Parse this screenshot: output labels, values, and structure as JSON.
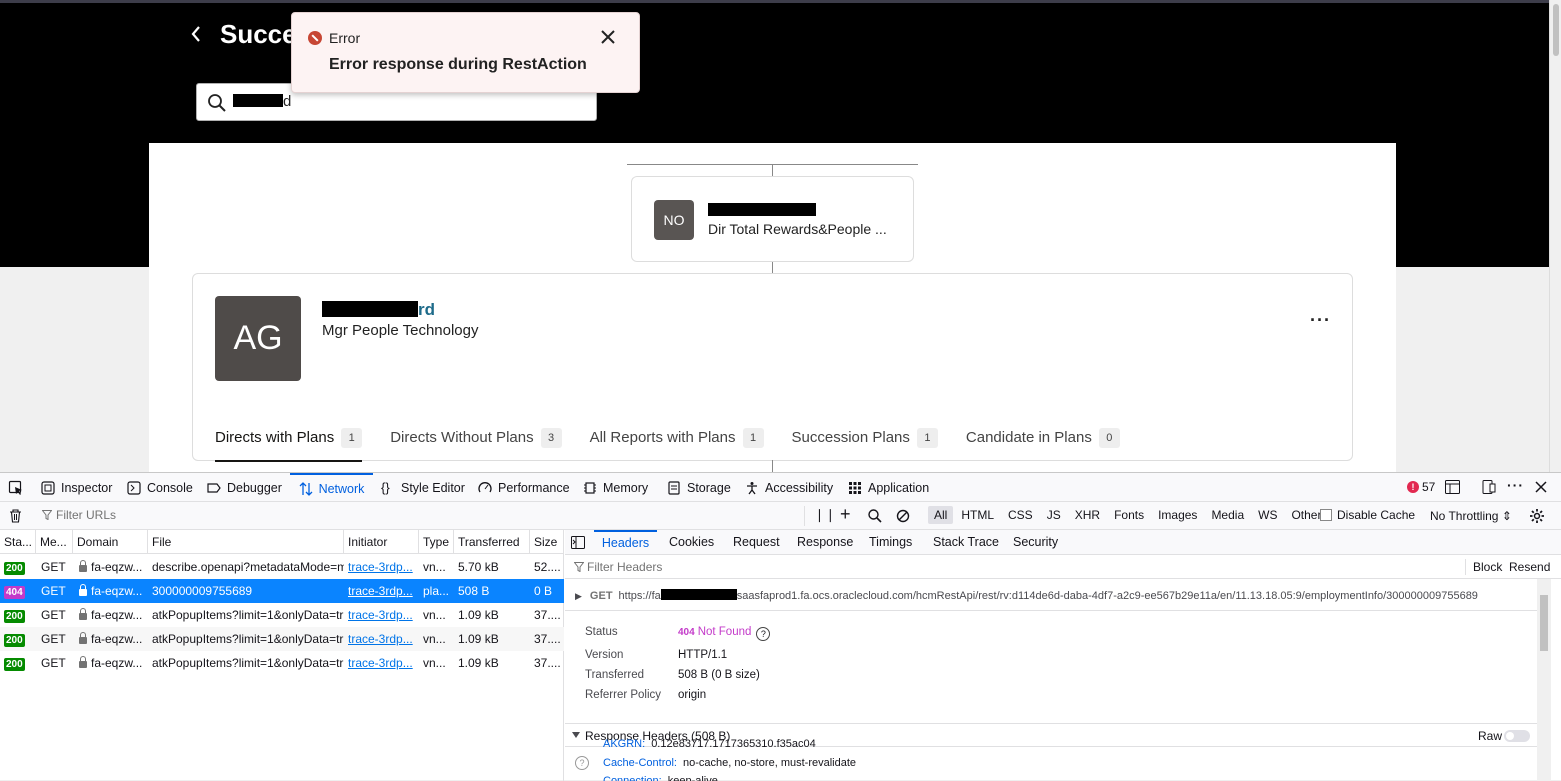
{
  "app": {
    "page_title": "Succes",
    "search_value_tail": "d",
    "toast": {
      "title": "Error",
      "message": "Error response during RestAction"
    },
    "manager": {
      "initials": "NO",
      "title": "Dir Total Rewards&People ..."
    },
    "employee": {
      "initials": "AG",
      "name_tail": "rd",
      "title": "Mgr People Technology",
      "more": "···"
    },
    "tabs": [
      {
        "label": "Directs with Plans",
        "count": "1"
      },
      {
        "label": "Directs Without Plans",
        "count": "3"
      },
      {
        "label": "All Reports with Plans",
        "count": "1"
      },
      {
        "label": "Succession Plans",
        "count": "1"
      },
      {
        "label": "Candidate in Plans",
        "count": "0"
      }
    ]
  },
  "devtools": {
    "tabs": [
      "Inspector",
      "Console",
      "Debugger",
      "Network",
      "Style Editor",
      "Performance",
      "Memory",
      "Storage",
      "Accessibility",
      "Application"
    ],
    "error_count": "57",
    "filter_placeholder": "Filter URLs",
    "type_filters": [
      "All",
      "HTML",
      "CSS",
      "JS",
      "XHR",
      "Fonts",
      "Images",
      "Media",
      "WS",
      "Other"
    ],
    "disable_cache": "Disable Cache",
    "throttling": "No Throttling ⇕",
    "columns": [
      "Sta...",
      "Me...",
      "Domain",
      "File",
      "Initiator",
      "Type",
      "Transferred",
      "Size"
    ],
    "requests": [
      {
        "status": "200",
        "method": "GET",
        "domain": "fa-eqzw...",
        "file": "describe.openapi?metadataMode=m",
        "initiator": "trace-3rdp...",
        "type": "vn...",
        "transferred": "5.70 kB",
        "size": "52...."
      },
      {
        "status": "404",
        "method": "GET",
        "domain": "fa-eqzw...",
        "file": "300000009755689",
        "initiator": "trace-3rdp...",
        "type": "pla...",
        "transferred": "508 B",
        "size": "0 B"
      },
      {
        "status": "200",
        "method": "GET",
        "domain": "fa-eqzw...",
        "file": "atkPopupItems?limit=1&onlyData=tr",
        "initiator": "trace-3rdp...",
        "type": "vn...",
        "transferred": "1.09 kB",
        "size": "37...."
      },
      {
        "status": "200",
        "method": "GET",
        "domain": "fa-eqzw...",
        "file": "atkPopupItems?limit=1&onlyData=tr",
        "initiator": "trace-3rdp...",
        "type": "vn...",
        "transferred": "1.09 kB",
        "size": "37...."
      },
      {
        "status": "200",
        "method": "GET",
        "domain": "fa-eqzw...",
        "file": "atkPopupItems?limit=1&onlyData=tr",
        "initiator": "trace-3rdp...",
        "type": "vn...",
        "transferred": "1.09 kB",
        "size": "37...."
      }
    ],
    "detail_tabs": [
      "Headers",
      "Cookies",
      "Request",
      "Response",
      "Timings",
      "Stack Trace",
      "Security"
    ],
    "filter_headers": "Filter Headers",
    "block": "Block",
    "resend": "Resend",
    "request_method": "GET",
    "request_url_start": "https://fa",
    "request_url_end": "saasfaprod1.fa.ocs.oraclecloud.com/hcmRestApi/rest/rv:d114de6d-daba-4df7-a2c9-ee567b29e11a/en/11.13.18.05:9/employmentInfo/300000009755689",
    "summary": [
      {
        "key": "Status",
        "code": "404",
        "value": "Not Found"
      },
      {
        "key": "Version",
        "value": "HTTP/1.1"
      },
      {
        "key": "Transferred",
        "value": "508 B (0 B size)"
      },
      {
        "key": "Referrer Policy",
        "value": "origin"
      }
    ],
    "response_headers_label": "Response Headers (508 B)",
    "raw_label": "Raw",
    "response_headers": [
      {
        "key": "AKGRN:",
        "value": "0.12e83717.1717365310.f35ac04"
      },
      {
        "key": "Cache-Control:",
        "value": "no-cache, no-store, must-revalidate"
      },
      {
        "key": "Connection:",
        "value": "keep-alive"
      }
    ]
  }
}
